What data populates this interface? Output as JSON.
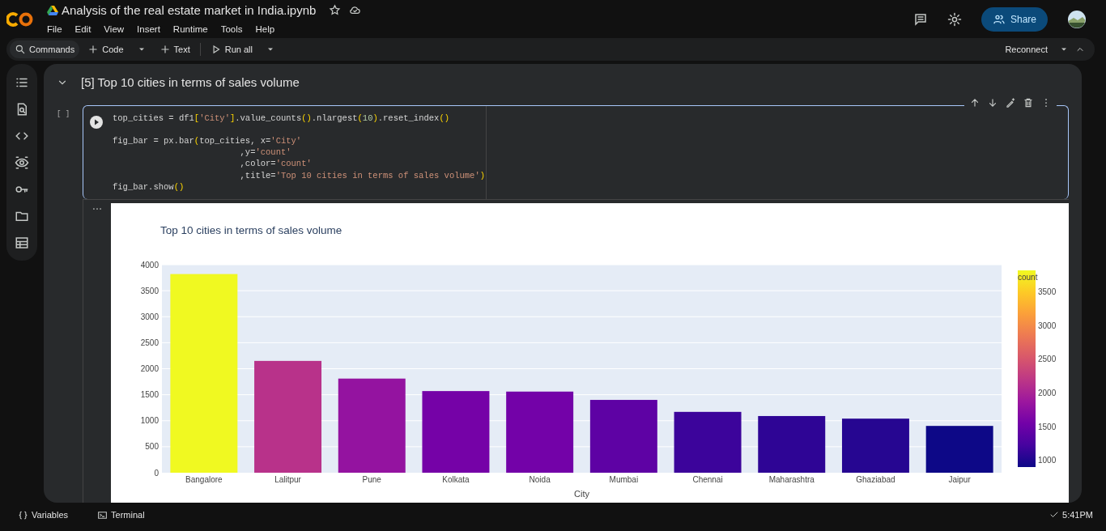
{
  "header": {
    "title": "Analysis of the real estate market in India.ipynb",
    "menu": [
      "File",
      "Edit",
      "View",
      "Insert",
      "Runtime",
      "Tools",
      "Help"
    ],
    "share_label": "Share"
  },
  "toolbar": {
    "items": [
      {
        "kind": "search",
        "label": "Commands"
      },
      {
        "kind": "add",
        "label": "Code",
        "caret": true
      },
      {
        "kind": "add",
        "label": "Text",
        "caret": false
      },
      {
        "kind": "run",
        "label": "Run all",
        "caret": true
      }
    ],
    "runtime_label": "Reconnect"
  },
  "section": {
    "title": "[5] Top 10 cities in terms of sales volume",
    "expanded": true
  },
  "cell": {
    "exec_count": "[ ]",
    "blocks": [
      [
        {
          "tokens": [
            {
              "kind": "plain",
              "text": "top_cities = df1"
            },
            {
              "kind": "paren",
              "text": "["
            },
            {
              "kind": "string",
              "text": "'City'"
            },
            {
              "kind": "paren",
              "text": "]"
            },
            {
              "kind": "plain",
              "text": ".value_counts"
            },
            {
              "kind": "paren",
              "text": "()"
            },
            {
              "kind": "plain",
              "text": ".nlargest"
            },
            {
              "kind": "paren",
              "text": "("
            },
            {
              "kind": "number",
              "text": "10"
            },
            {
              "kind": "paren",
              "text": ")"
            },
            {
              "kind": "plain",
              "text": ".reset_index"
            },
            {
              "kind": "paren",
              "text": "()"
            }
          ]
        }
      ],
      [
        {
          "tokens": [
            {
              "kind": "plain",
              "text": "fig_bar = px.bar"
            },
            {
              "kind": "paren",
              "text": "("
            },
            {
              "kind": "plain",
              "text": "top_cities, x="
            },
            {
              "kind": "string",
              "text": "'City'"
            }
          ]
        },
        {
          "tokens": [
            {
              "kind": "plain",
              "text": "                         ,y="
            },
            {
              "kind": "string",
              "text": "'count'"
            }
          ]
        },
        {
          "tokens": [
            {
              "kind": "plain",
              "text": "                         ,color="
            },
            {
              "kind": "string",
              "text": "'count'"
            }
          ]
        },
        {
          "tokens": [
            {
              "kind": "plain",
              "text": "                         ,title="
            },
            {
              "kind": "string",
              "text": "'Top 10 cities in terms of sales volume'"
            },
            {
              "kind": "paren",
              "text": ")"
            }
          ]
        },
        {
          "tokens": [
            {
              "kind": "plain",
              "text": "fig_bar.show"
            },
            {
              "kind": "paren",
              "text": "()"
            }
          ]
        }
      ]
    ]
  },
  "output": {
    "chart_data": {
      "type": "bar",
      "title": "Top 10 cities in terms of sales volume",
      "xlabel": "City",
      "categories": [
        "Bangalore",
        "Lalitpur",
        "Pune",
        "Kolkata",
        "Noida",
        "Mumbai",
        "Chennai",
        "Maharashtra",
        "Ghaziabad",
        "Jaipur"
      ],
      "values": [
        3820,
        2150,
        1810,
        1570,
        1560,
        1400,
        1170,
        1090,
        1040,
        900
      ],
      "ylim": [
        0,
        4000
      ],
      "grid": true,
      "yticks": [
        0,
        500,
        1000,
        1500,
        2000,
        2500,
        3000,
        3500,
        4000
      ]
    },
    "colorbar": {
      "title": "count",
      "ticks": [
        "3500",
        "3000",
        "2500",
        "2000",
        "1500",
        "1000"
      ]
    }
  },
  "status_bar": {
    "items": [
      {
        "kind": "variables",
        "label": "Variables"
      },
      {
        "kind": "terminal",
        "label": "Terminal"
      }
    ],
    "time": "5:41PM"
  }
}
